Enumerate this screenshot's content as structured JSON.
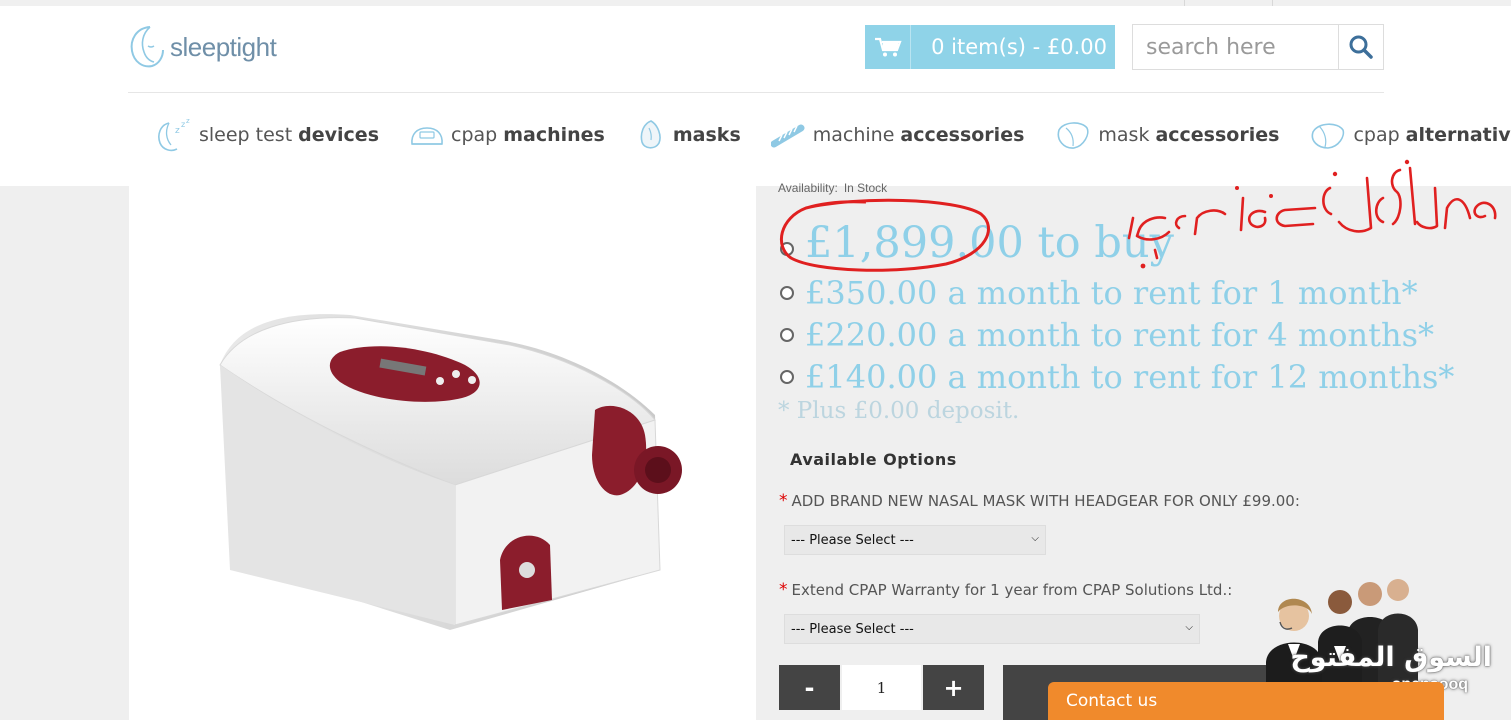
{
  "header": {
    "logo_text": "sleeptight",
    "cart_label": "0 item(s) - £0.00",
    "search_placeholder": "search here"
  },
  "nav": [
    {
      "light": "sleep test",
      "bold": "devices",
      "icon": "sleep-z-icon"
    },
    {
      "light": "cpap",
      "bold": "machines",
      "icon": "cpap-device-icon"
    },
    {
      "light": "",
      "bold": "masks",
      "icon": "mask-icon"
    },
    {
      "light": "machine",
      "bold": "accessories",
      "icon": "tube-icon"
    },
    {
      "light": "mask",
      "bold": "accessories",
      "icon": "mask-accessory-icon"
    },
    {
      "light": "cpap",
      "bold": "alternative",
      "icon": "alternative-icon"
    }
  ],
  "product": {
    "availability_label": "Availability:",
    "availability_value": "In Stock",
    "prices": [
      "£1,899.00 to buy",
      "£350.00 a month to rent for 1 month*",
      "£220.00 a month to rent for 4 months*",
      "£140.00 a month to rent for 12 months*"
    ],
    "deposit_note": "* Plus £0.00 deposit.",
    "options_title": "Available Options",
    "options": [
      {
        "required": "*",
        "label": "ADD BRAND NEW NASAL MASK WITH HEADGEAR FOR ONLY £99.00:",
        "selected": "--- Please Select ---"
      },
      {
        "required": "*",
        "label": "Extend CPAP Warranty for 1 year from CPAP Solutions Ltd.:",
        "selected": "--- Please Select ---"
      }
    ],
    "qty_minus": "-",
    "qty_value": "1",
    "qty_plus": "+"
  },
  "contact_label": "Contact us",
  "watermark": {
    "arabic": "السوق المفتوح",
    "latin": "opensooq"
  },
  "colors": {
    "cart_bg": "#8fd3e8",
    "price": "#8fd0e8",
    "annotation": "#e02020",
    "contact_bg": "#f08a2c",
    "button_dark": "#444444"
  }
}
